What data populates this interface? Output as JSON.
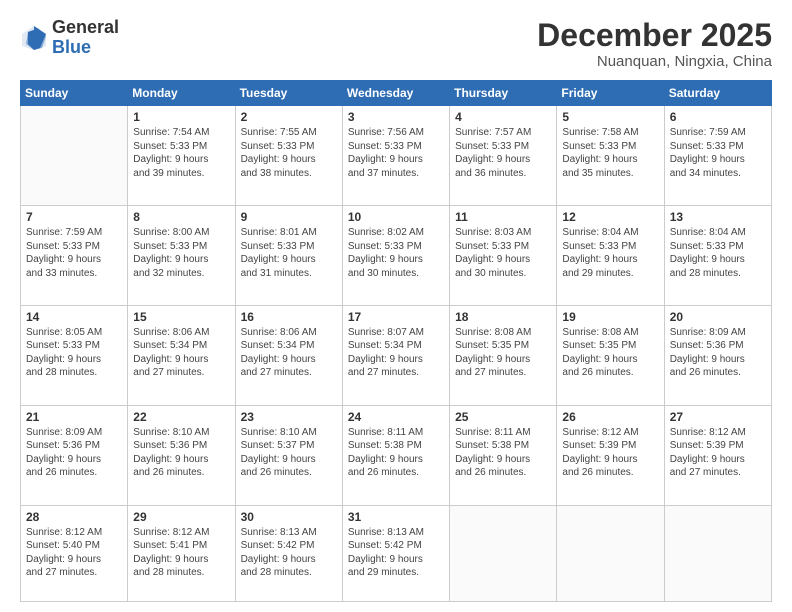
{
  "header": {
    "logo_general": "General",
    "logo_blue": "Blue",
    "month_title": "December 2025",
    "location": "Nuanquan, Ningxia, China"
  },
  "weekdays": [
    "Sunday",
    "Monday",
    "Tuesday",
    "Wednesday",
    "Thursday",
    "Friday",
    "Saturday"
  ],
  "weeks": [
    [
      {
        "num": "",
        "info": ""
      },
      {
        "num": "1",
        "info": "Sunrise: 7:54 AM\nSunset: 5:33 PM\nDaylight: 9 hours\nand 39 minutes."
      },
      {
        "num": "2",
        "info": "Sunrise: 7:55 AM\nSunset: 5:33 PM\nDaylight: 9 hours\nand 38 minutes."
      },
      {
        "num": "3",
        "info": "Sunrise: 7:56 AM\nSunset: 5:33 PM\nDaylight: 9 hours\nand 37 minutes."
      },
      {
        "num": "4",
        "info": "Sunrise: 7:57 AM\nSunset: 5:33 PM\nDaylight: 9 hours\nand 36 minutes."
      },
      {
        "num": "5",
        "info": "Sunrise: 7:58 AM\nSunset: 5:33 PM\nDaylight: 9 hours\nand 35 minutes."
      },
      {
        "num": "6",
        "info": "Sunrise: 7:59 AM\nSunset: 5:33 PM\nDaylight: 9 hours\nand 34 minutes."
      }
    ],
    [
      {
        "num": "7",
        "info": "Sunrise: 7:59 AM\nSunset: 5:33 PM\nDaylight: 9 hours\nand 33 minutes."
      },
      {
        "num": "8",
        "info": "Sunrise: 8:00 AM\nSunset: 5:33 PM\nDaylight: 9 hours\nand 32 minutes."
      },
      {
        "num": "9",
        "info": "Sunrise: 8:01 AM\nSunset: 5:33 PM\nDaylight: 9 hours\nand 31 minutes."
      },
      {
        "num": "10",
        "info": "Sunrise: 8:02 AM\nSunset: 5:33 PM\nDaylight: 9 hours\nand 30 minutes."
      },
      {
        "num": "11",
        "info": "Sunrise: 8:03 AM\nSunset: 5:33 PM\nDaylight: 9 hours\nand 30 minutes."
      },
      {
        "num": "12",
        "info": "Sunrise: 8:04 AM\nSunset: 5:33 PM\nDaylight: 9 hours\nand 29 minutes."
      },
      {
        "num": "13",
        "info": "Sunrise: 8:04 AM\nSunset: 5:33 PM\nDaylight: 9 hours\nand 28 minutes."
      }
    ],
    [
      {
        "num": "14",
        "info": "Sunrise: 8:05 AM\nSunset: 5:33 PM\nDaylight: 9 hours\nand 28 minutes."
      },
      {
        "num": "15",
        "info": "Sunrise: 8:06 AM\nSunset: 5:34 PM\nDaylight: 9 hours\nand 27 minutes."
      },
      {
        "num": "16",
        "info": "Sunrise: 8:06 AM\nSunset: 5:34 PM\nDaylight: 9 hours\nand 27 minutes."
      },
      {
        "num": "17",
        "info": "Sunrise: 8:07 AM\nSunset: 5:34 PM\nDaylight: 9 hours\nand 27 minutes."
      },
      {
        "num": "18",
        "info": "Sunrise: 8:08 AM\nSunset: 5:35 PM\nDaylight: 9 hours\nand 27 minutes."
      },
      {
        "num": "19",
        "info": "Sunrise: 8:08 AM\nSunset: 5:35 PM\nDaylight: 9 hours\nand 26 minutes."
      },
      {
        "num": "20",
        "info": "Sunrise: 8:09 AM\nSunset: 5:36 PM\nDaylight: 9 hours\nand 26 minutes."
      }
    ],
    [
      {
        "num": "21",
        "info": "Sunrise: 8:09 AM\nSunset: 5:36 PM\nDaylight: 9 hours\nand 26 minutes."
      },
      {
        "num": "22",
        "info": "Sunrise: 8:10 AM\nSunset: 5:36 PM\nDaylight: 9 hours\nand 26 minutes."
      },
      {
        "num": "23",
        "info": "Sunrise: 8:10 AM\nSunset: 5:37 PM\nDaylight: 9 hours\nand 26 minutes."
      },
      {
        "num": "24",
        "info": "Sunrise: 8:11 AM\nSunset: 5:38 PM\nDaylight: 9 hours\nand 26 minutes."
      },
      {
        "num": "25",
        "info": "Sunrise: 8:11 AM\nSunset: 5:38 PM\nDaylight: 9 hours\nand 26 minutes."
      },
      {
        "num": "26",
        "info": "Sunrise: 8:12 AM\nSunset: 5:39 PM\nDaylight: 9 hours\nand 26 minutes."
      },
      {
        "num": "27",
        "info": "Sunrise: 8:12 AM\nSunset: 5:39 PM\nDaylight: 9 hours\nand 27 minutes."
      }
    ],
    [
      {
        "num": "28",
        "info": "Sunrise: 8:12 AM\nSunset: 5:40 PM\nDaylight: 9 hours\nand 27 minutes."
      },
      {
        "num": "29",
        "info": "Sunrise: 8:12 AM\nSunset: 5:41 PM\nDaylight: 9 hours\nand 28 minutes."
      },
      {
        "num": "30",
        "info": "Sunrise: 8:13 AM\nSunset: 5:42 PM\nDaylight: 9 hours\nand 28 minutes."
      },
      {
        "num": "31",
        "info": "Sunrise: 8:13 AM\nSunset: 5:42 PM\nDaylight: 9 hours\nand 29 minutes."
      },
      {
        "num": "",
        "info": ""
      },
      {
        "num": "",
        "info": ""
      },
      {
        "num": "",
        "info": ""
      }
    ]
  ]
}
